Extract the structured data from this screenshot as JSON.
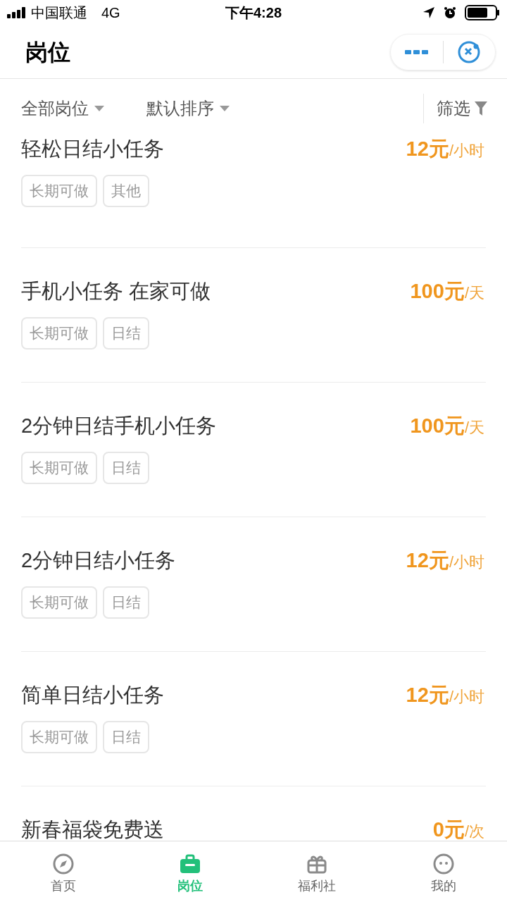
{
  "status_bar": {
    "carrier": "中国联通",
    "network": "4G",
    "time": "下午4:28"
  },
  "header": {
    "title": "岗位"
  },
  "filters": [
    {
      "label": "全部岗位",
      "kind": "dropdown"
    },
    {
      "label": "默认排序",
      "kind": "dropdown"
    }
  ],
  "filter_button": {
    "label": "筛选"
  },
  "jobs": [
    {
      "title": "轻松日结小任务",
      "pay": "12元",
      "unit": "/小时",
      "tags": [
        "长期可做",
        "其他"
      ]
    },
    {
      "title": "手机小任务 在家可做",
      "pay": "100元",
      "unit": "/天",
      "tags": [
        "长期可做",
        "日结"
      ]
    },
    {
      "title": "2分钟日结手机小任务",
      "pay": "100元",
      "unit": "/天",
      "tags": [
        "长期可做",
        "日结"
      ]
    },
    {
      "title": "2分钟日结小任务",
      "pay": "12元",
      "unit": "/小时",
      "tags": [
        "长期可做",
        "日结"
      ]
    },
    {
      "title": "简单日结小任务",
      "pay": "12元",
      "unit": "/小时",
      "tags": [
        "长期可做",
        "日结"
      ]
    },
    {
      "title": "新春福袋免费送",
      "pay": "0元",
      "unit": "/次"
    }
  ],
  "tab_bar": [
    {
      "label": "首页",
      "kind": "compass",
      "selected": false
    },
    {
      "label": "岗位",
      "kind": "briefcase",
      "selected": true
    },
    {
      "label": "福利社",
      "kind": "gift",
      "selected": false
    },
    {
      "label": "我的",
      "kind": "face",
      "selected": false
    }
  ]
}
